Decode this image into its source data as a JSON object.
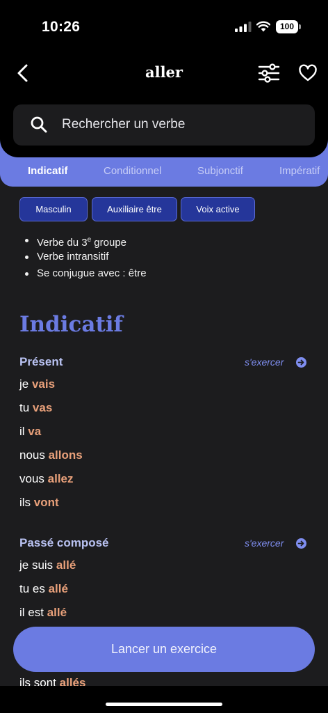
{
  "status": {
    "time": "10:26",
    "battery": "100"
  },
  "nav": {
    "title": "aller"
  },
  "search": {
    "placeholder": "Rechercher un verbe"
  },
  "tabs": [
    {
      "label": "Indicatif",
      "active": true
    },
    {
      "label": "Conditionnel",
      "active": false
    },
    {
      "label": "Subjonctif",
      "active": false
    },
    {
      "label": "Impératif",
      "active": false
    }
  ],
  "chips": [
    "Masculin",
    "Auxiliaire être",
    "Voix active"
  ],
  "info": {
    "group_prefix": "Verbe du 3",
    "group_sup": "e",
    "group_suffix": " groupe",
    "type": "Verbe intransitif",
    "auxiliary": "Se conjugue avec : être"
  },
  "section": {
    "title": "Indicatif"
  },
  "exercise_label": "s'exercer",
  "present": {
    "title": "Présent",
    "lines": [
      {
        "pronoun": "je ",
        "verb": "vais"
      },
      {
        "pronoun": "tu ",
        "verb": "vas"
      },
      {
        "pronoun": "il ",
        "verb": "va"
      },
      {
        "pronoun": "nous ",
        "verb": "allons"
      },
      {
        "pronoun": "vous ",
        "verb": "allez"
      },
      {
        "pronoun": "ils ",
        "verb": "vont"
      }
    ]
  },
  "passe_compose": {
    "title": "Passé composé",
    "lines": [
      {
        "pronoun": "je suis ",
        "verb": "allé"
      },
      {
        "pronoun": "tu es ",
        "verb": "allé"
      },
      {
        "pronoun": "il est ",
        "verb": "allé"
      },
      {
        "pronoun": "ils sont ",
        "verb": "allés"
      }
    ]
  },
  "cta": {
    "label": "Lancer un exercice"
  },
  "colors": {
    "accent": "#6b7be2",
    "verb": "#e8a07a",
    "background": "#1c1c1e"
  }
}
